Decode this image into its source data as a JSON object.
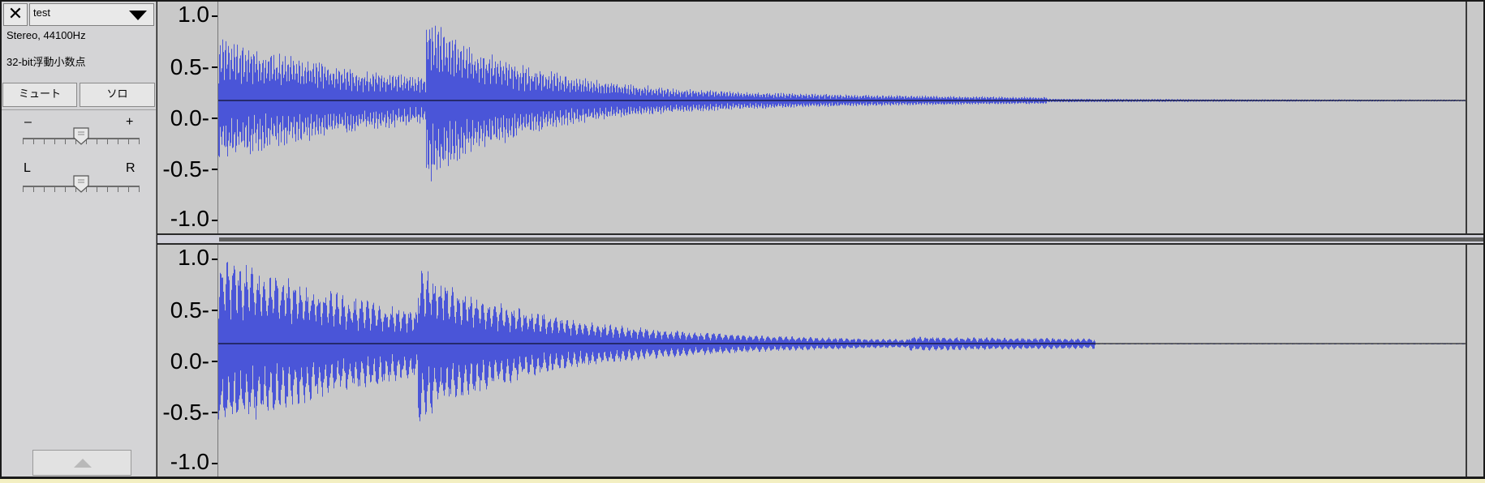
{
  "track": {
    "close_glyph": "✕",
    "name": "test",
    "format": "Stereo, 44100Hz",
    "bit_depth": "32-bit浮動小数点",
    "mute_label": "ミュート",
    "solo_label": "ソロ",
    "gain_minus": "–",
    "gain_plus": "+",
    "pan_left": "L",
    "pan_right": "R",
    "gain_level": 0.5,
    "pan_level": 0.5
  },
  "ruler": {
    "labels": [
      "1.0",
      "0.5-",
      "0.0-",
      "-0.5-",
      "-1.0"
    ],
    "values": [
      1.0,
      0.5,
      0.0,
      -0.5,
      -1.0
    ]
  },
  "colors": {
    "waveform": "#4a55d8",
    "background": "#c9c9c9",
    "panel": "#d4d4d6"
  }
}
